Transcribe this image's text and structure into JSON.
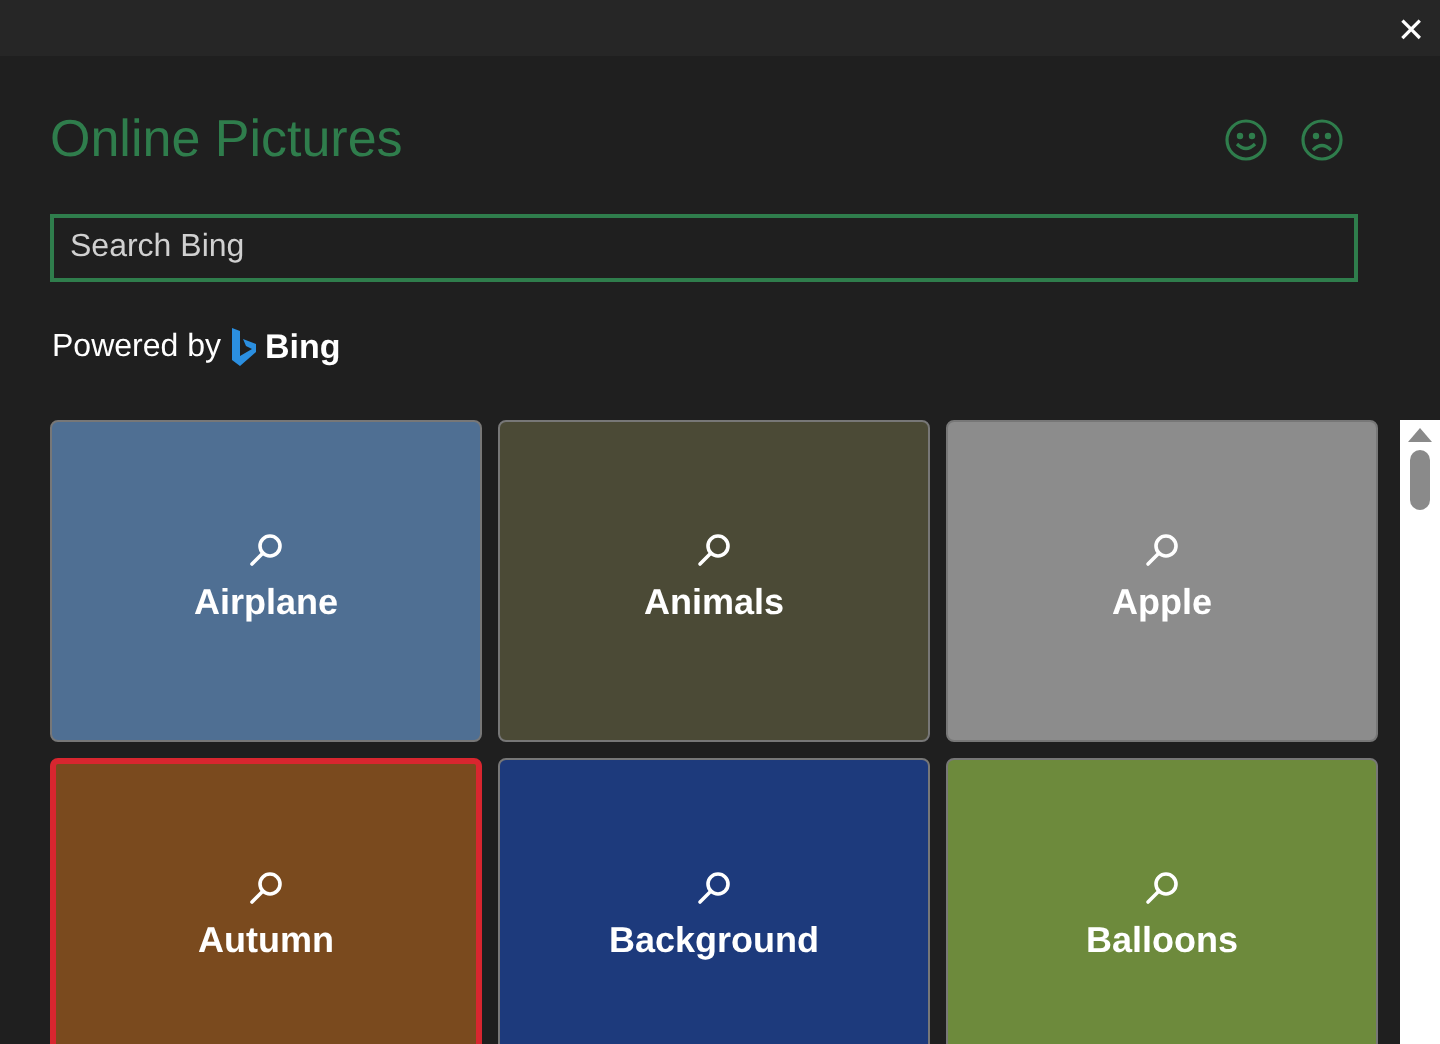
{
  "window": {
    "close": "×"
  },
  "title": "Online Pictures",
  "search": {
    "placeholder": "Search Bing"
  },
  "powered_by": {
    "prefix": "Powered by",
    "brand": "Bing"
  },
  "tiles": [
    {
      "label": "Airplane",
      "selected": false,
      "color": "#4f6f93"
    },
    {
      "label": "Animals",
      "selected": false,
      "color": "#4b4a36"
    },
    {
      "label": "Apple",
      "selected": false,
      "color": "#8c8c8c"
    },
    {
      "label": "Autumn",
      "selected": true,
      "color": "#7a4a1e"
    },
    {
      "label": "Background",
      "selected": false,
      "color": "#1d3a7c"
    },
    {
      "label": "Balloons",
      "selected": false,
      "color": "#6d8a3c"
    }
  ]
}
